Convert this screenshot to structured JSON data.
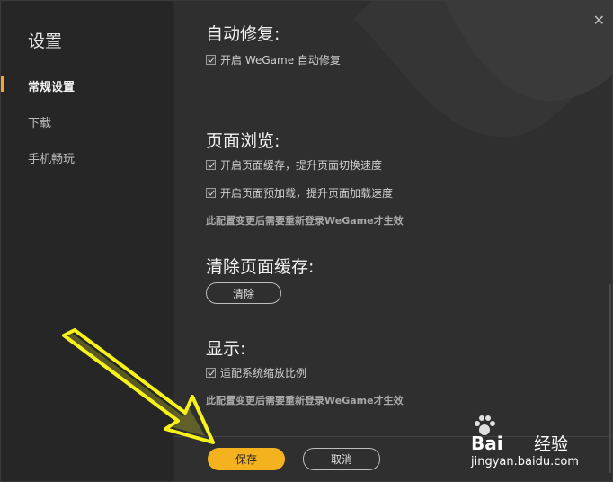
{
  "sidebar": {
    "title": "设置",
    "items": [
      {
        "label": "常规设置"
      },
      {
        "label": "下载"
      },
      {
        "label": "手机畅玩"
      }
    ]
  },
  "main": {
    "close_glyph": "✕",
    "sections": {
      "auto_repair": {
        "title": "自动修复:",
        "option": "开启 WeGame 自动修复"
      },
      "browse": {
        "title": "页面浏览:",
        "options": [
          "开启页面缓存，提升页面切换速度",
          "开启页面预加载，提升页面加载速度"
        ],
        "note": "此配置变更后需要重新登录WeGame才生效"
      },
      "cache": {
        "title": "清除页面缓存:",
        "button": "清除"
      },
      "display": {
        "title": "显示:",
        "option": "适配系统缩放比例",
        "note": "此配置变更后需要重新登录WeGame才生效"
      }
    },
    "footer": {
      "save": "保存",
      "cancel": "取消"
    }
  },
  "watermark": {
    "brand": "Bai",
    "brand2": "经验",
    "url": "jingyan.baidu.com"
  },
  "colors": {
    "accent": "#f5a623",
    "save_button": "#f5b21f",
    "arrow": "#f7f21a"
  }
}
